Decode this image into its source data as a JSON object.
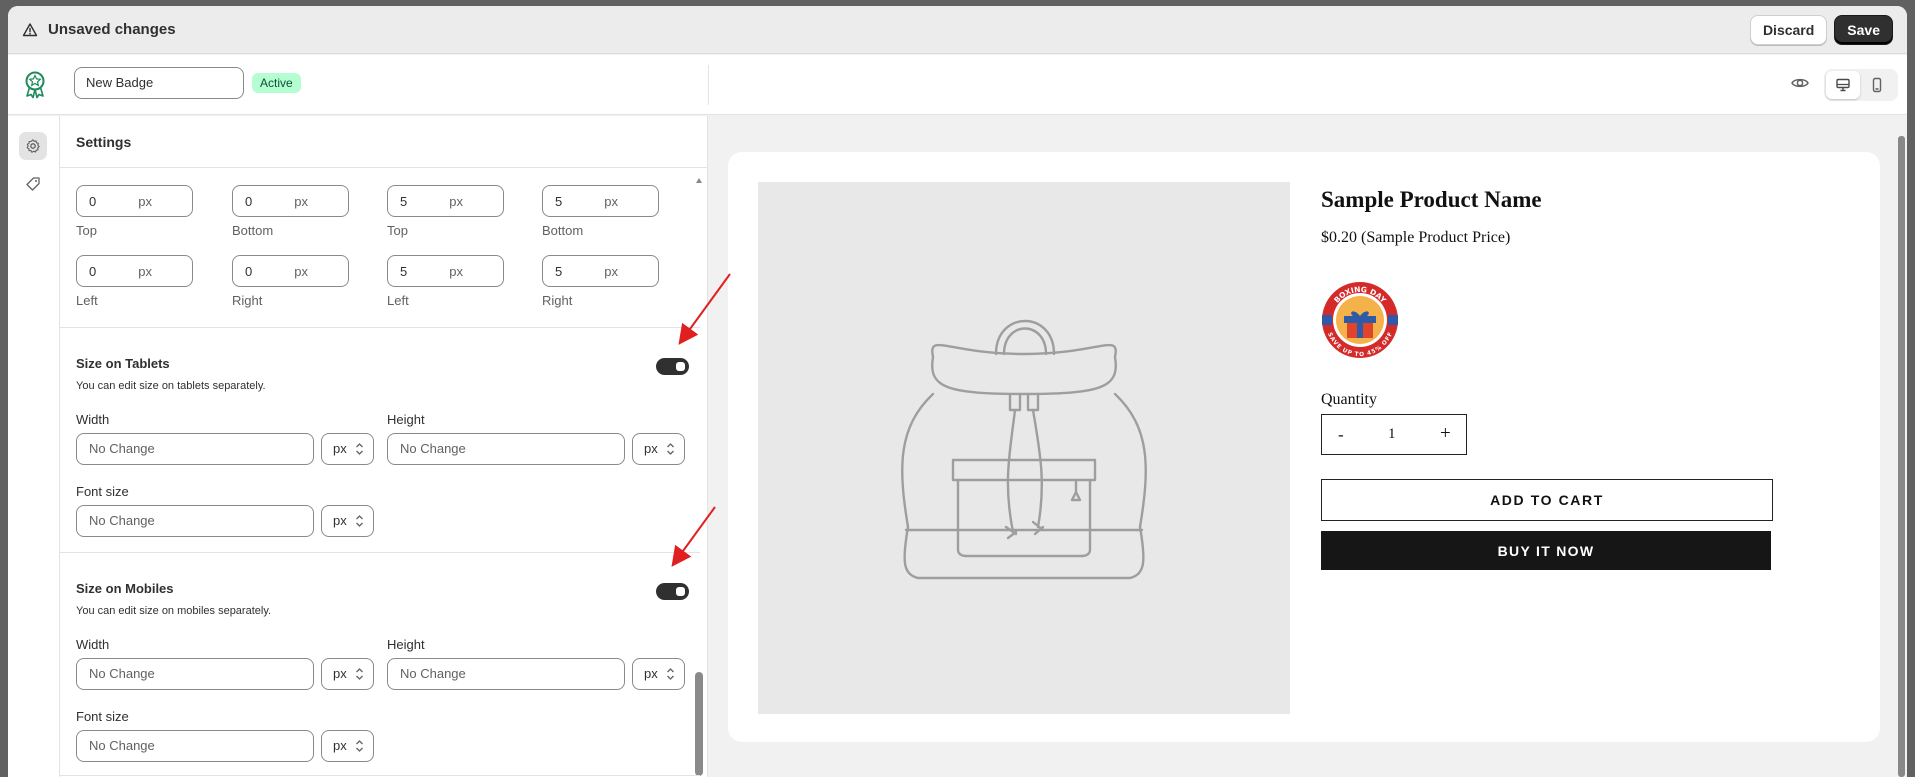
{
  "topbar": {
    "title": "Unsaved changes",
    "discard_label": "Discard",
    "save_label": "Save"
  },
  "header": {
    "badge_name": "New Badge",
    "status": "Active"
  },
  "settings": {
    "title": "Settings",
    "padding_rows": [
      [
        {
          "value": "0",
          "unit": "px",
          "label": "Top"
        },
        {
          "value": "0",
          "unit": "px",
          "label": "Bottom"
        },
        {
          "value": "5",
          "unit": "px",
          "label": "Top"
        },
        {
          "value": "5",
          "unit": "px",
          "label": "Bottom"
        }
      ],
      [
        {
          "value": "0",
          "unit": "px",
          "label": "Left"
        },
        {
          "value": "0",
          "unit": "px",
          "label": "Right"
        },
        {
          "value": "5",
          "unit": "px",
          "label": "Left"
        },
        {
          "value": "5",
          "unit": "px",
          "label": "Right"
        }
      ]
    ],
    "tablets": {
      "title": "Size on Tablets",
      "subtitle": "You can edit size on tablets separately.",
      "enabled": true,
      "width_label": "Width",
      "height_label": "Height",
      "font_size_label": "Font size",
      "width_placeholder": "No Change",
      "height_placeholder": "No Change",
      "font_placeholder": "No Change",
      "unit": "px"
    },
    "mobiles": {
      "title": "Size on Mobiles",
      "subtitle": "You can edit size on mobiles separately.",
      "enabled": true,
      "width_label": "Width",
      "height_label": "Height",
      "font_size_label": "Font size",
      "width_placeholder": "No Change",
      "height_placeholder": "No Change",
      "font_placeholder": "No Change",
      "unit": "px"
    }
  },
  "preview": {
    "product_name": "Sample Product Name",
    "price": "$0.20 (Sample Product Price)",
    "quantity_label": "Quantity",
    "quantity": "1",
    "minus": "-",
    "plus": "+",
    "add_to_cart": "ADD TO CART",
    "buy_now": "BUY IT NOW",
    "badge": {
      "line1": "BOXING DAY",
      "line2": "SAVE UP TO 45% OFF"
    }
  },
  "colors": {
    "accent_dark": "#303030",
    "active_badge_bg": "#b4fed2",
    "annotation_arrow": "#e02020",
    "promo_red": "#d42a2a",
    "promo_blue": "#2f5aa8"
  },
  "icons": [
    "warning-icon",
    "app-logo-icon",
    "eye-icon",
    "desktop-icon",
    "mobile-icon",
    "gear-icon",
    "tag-icon"
  ]
}
